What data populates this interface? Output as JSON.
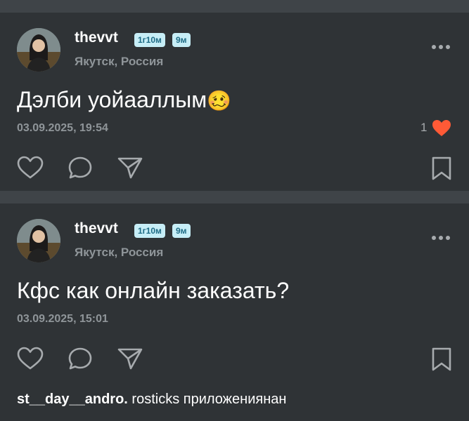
{
  "posts": [
    {
      "username": "thevvt",
      "badges": [
        "1г10м",
        "9м"
      ],
      "location": "Якутск, Россия",
      "text": "Дэлби уойааллым",
      "emoji": "🥴",
      "date": "03.09.2025, 19:54",
      "likes": "1"
    },
    {
      "username": "thevvt",
      "badges": [
        "1г10м",
        "9м"
      ],
      "location": "Якутск, Россия",
      "text": "Кфс как онлайн заказать?",
      "date": "03.09.2025, 15:01"
    }
  ],
  "comment": {
    "author": "st__day__andro.",
    "text": "rosticks приложениянан"
  },
  "colors": {
    "background": "#2f3336",
    "separator": "#3f4448",
    "badge_bg": "#c7eef7",
    "like_heart": "#ff5a36"
  },
  "icons": [
    "heart-icon",
    "comment-icon",
    "share-icon",
    "bookmark-icon",
    "more-icon"
  ]
}
